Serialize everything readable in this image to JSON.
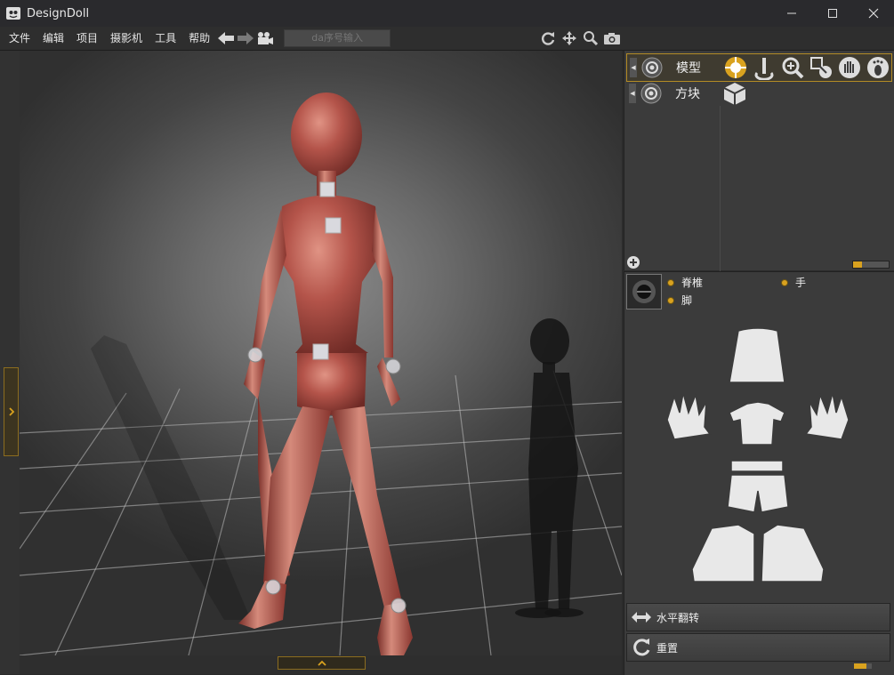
{
  "window": {
    "title": "DesignDoll"
  },
  "menu": {
    "items": [
      "文件",
      "编辑",
      "项目",
      "摄影机",
      "工具",
      "帮助"
    ]
  },
  "toolbar": {
    "search_placeholder": "da序号输入"
  },
  "layers": [
    {
      "label": "模型",
      "selected": true
    },
    {
      "label": "方块",
      "selected": false
    }
  ],
  "parts": {
    "spine": "脊椎",
    "hand": "手",
    "foot": "脚"
  },
  "actions": {
    "flip": "水平翻转",
    "reset": "重置"
  },
  "colors": {
    "accent": "#d9a21f",
    "panel": "#3b3b3b",
    "doll": "#b5534a"
  }
}
